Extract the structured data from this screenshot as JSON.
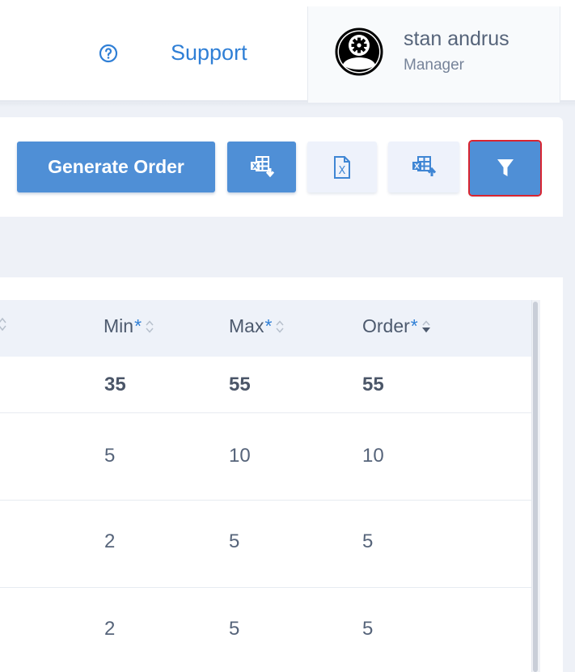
{
  "header": {
    "support_label": "Support",
    "user": {
      "name": "stan andrus",
      "role": "Manager"
    }
  },
  "toolbar": {
    "generate_order_label": "Generate Order",
    "icons": [
      "excel-export-icon",
      "excel-file-icon",
      "excel-import-icon",
      "filter-icon"
    ],
    "accent_color": "#4f8fd6",
    "highlight_color": "#d92430"
  },
  "table": {
    "columns": [
      {
        "label": "Min",
        "required_mark": "*"
      },
      {
        "label": "Max",
        "required_mark": "*"
      },
      {
        "label": "Order",
        "required_mark": "*"
      }
    ],
    "rows": [
      {
        "min": "35",
        "max": "55",
        "order": "55"
      },
      {
        "min": "5",
        "max": "10",
        "order": "10"
      },
      {
        "min": "2",
        "max": "5",
        "order": "5"
      },
      {
        "min": "2",
        "max": "5",
        "order": "5"
      }
    ]
  }
}
